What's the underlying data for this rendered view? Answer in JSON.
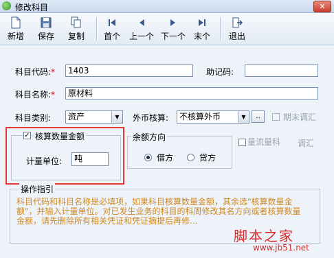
{
  "window": {
    "title": "修改科目",
    "close_label": "✕"
  },
  "toolbar": {
    "new": "新增",
    "save": "保存",
    "copy": "复制",
    "first": "首个",
    "prev": "上一个",
    "next": "下一个",
    "last": "末个",
    "exit": "退出"
  },
  "form": {
    "code_label": "科目代码:",
    "code_value": "1403",
    "mnemonic_label": "助记码:",
    "mnemonic_value": "",
    "name_label": "科目名称:",
    "name_value": "原材料",
    "category_label": "科目类别:",
    "category_value": "资产",
    "currency_label": "外币核算:",
    "currency_value": "不核算外币",
    "currency_more": "..",
    "period_end_label": "期末调汇",
    "qty_checkbox_label": "核算数量金额",
    "unit_label": "计量单位:",
    "unit_value": "吨",
    "balance_group_label": "余额方向",
    "debit_label": "借方",
    "credit_label": "贷方",
    "cashflow_label": "量流量科",
    "adjust_label": "调汇"
  },
  "guide": {
    "title": "操作指引",
    "text": "科目代码和科目名称是必填项，如果科目核算数量金额，其余选\"核算数量金额\"，并输入计量单位。对已发生业务的科目的科周修改其名方向或者核算数量金额，请先删除所有相关凭证和凭证摘提后再修..."
  },
  "watermark": {
    "brand": "脚本之家",
    "url": "www.jb51.net"
  },
  "colors": {
    "required": "#d40000",
    "highlight": "#e53935",
    "guide_text": "#d08a20",
    "watermark": "#d62a2a"
  }
}
